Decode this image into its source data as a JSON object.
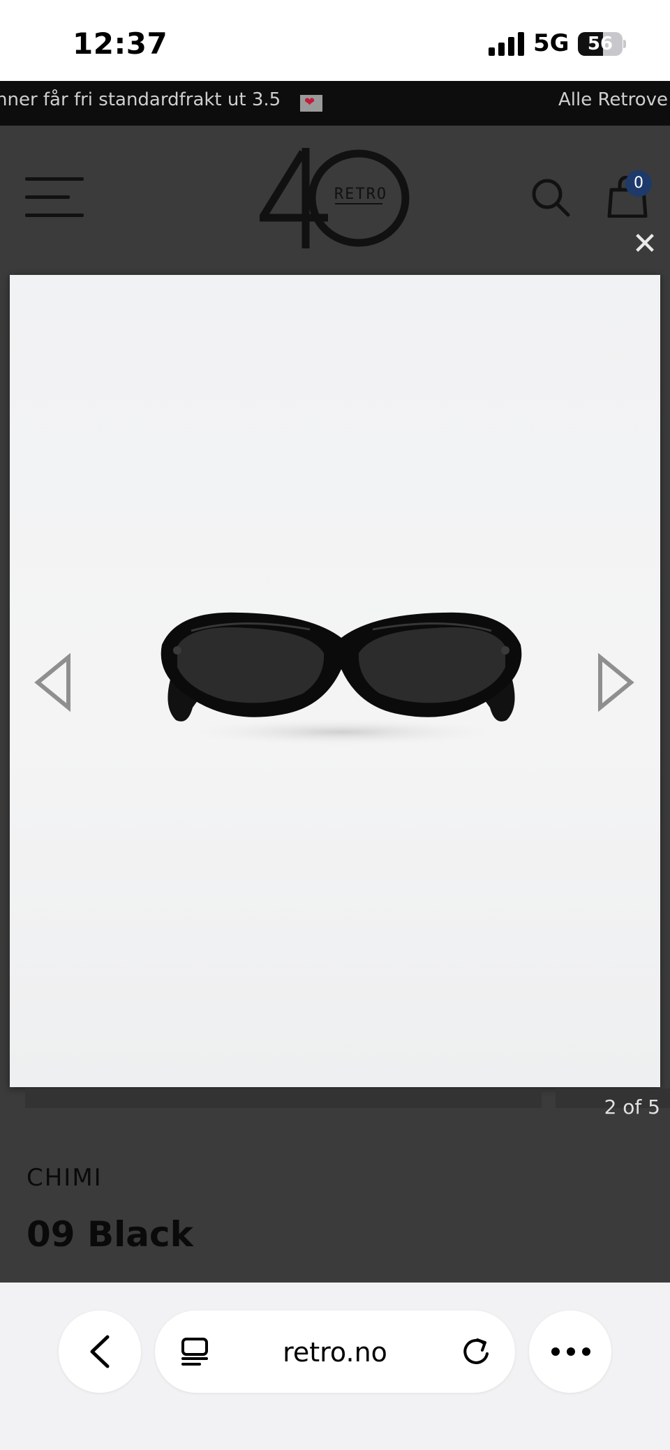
{
  "status_bar": {
    "time": "12:37",
    "network": "5G",
    "battery_level": "56",
    "battery_fraction": 0.56
  },
  "announcement": {
    "text_left": "nner får fri standardfrakt ut 3.5",
    "text_right": "Alle Retrove",
    "heart_glyph": "❤"
  },
  "header": {
    "logo_text": "RETRO",
    "cart_count": "0"
  },
  "lightbox": {
    "close_glyph": "✕",
    "counter": "2 of 5"
  },
  "product": {
    "brand": "CHIMI",
    "title": "09 Black"
  },
  "browser": {
    "url": "retro.no"
  },
  "colors": {
    "overlay": "#3b3b3b",
    "banner": "#0d0d0d",
    "badge": "#1d3a6b",
    "heart": "#c41c3b",
    "toolbar": "#f2f2f4"
  }
}
